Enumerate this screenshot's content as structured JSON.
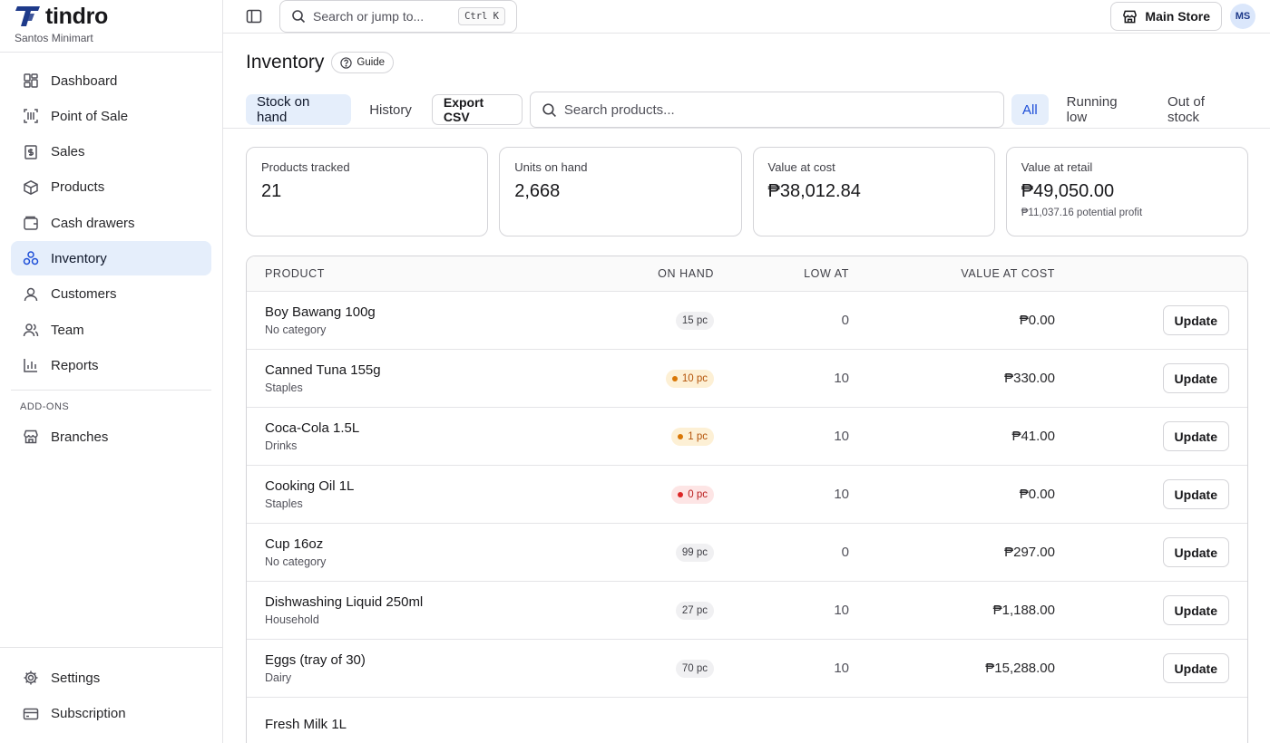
{
  "brand": {
    "name": "tindro",
    "subtitle": "Santos Minimart",
    "accent": "#1e3a8a"
  },
  "nav": {
    "items": [
      {
        "label": "Dashboard",
        "icon": "dashboard-icon"
      },
      {
        "label": "Point of Sale",
        "icon": "barcode-icon"
      },
      {
        "label": "Sales",
        "icon": "receipt-icon"
      },
      {
        "label": "Products",
        "icon": "box-icon"
      },
      {
        "label": "Cash drawers",
        "icon": "wallet-icon"
      },
      {
        "label": "Inventory",
        "icon": "boxes-icon",
        "active": true
      },
      {
        "label": "Customers",
        "icon": "user-icon"
      },
      {
        "label": "Team",
        "icon": "users-icon"
      },
      {
        "label": "Reports",
        "icon": "chart-icon"
      }
    ],
    "addons_title": "ADD-ONS",
    "addons": [
      {
        "label": "Branches",
        "icon": "store-icon"
      }
    ],
    "bottom": [
      {
        "label": "Settings",
        "icon": "gear-icon"
      },
      {
        "label": "Subscription",
        "icon": "credit-card-icon"
      }
    ]
  },
  "topbar": {
    "search_placeholder": "Search or jump to...",
    "search_shortcut": "Ctrl K",
    "store_label": "Main Store",
    "avatar_initials": "MS"
  },
  "page": {
    "title": "Inventory",
    "guide_label": "Guide",
    "tabs": [
      "Stock on hand",
      "History"
    ],
    "export_label": "Export CSV",
    "search_placeholder": "Search products...",
    "filters": [
      "All",
      "Running low",
      "Out of stock"
    ]
  },
  "stats": [
    {
      "label": "Products tracked",
      "value": "21",
      "note": ""
    },
    {
      "label": "Units on hand",
      "value": "2,668",
      "note": ""
    },
    {
      "label": "Value at cost",
      "value": "₱38,012.84",
      "note": ""
    },
    {
      "label": "Value at retail",
      "value": "₱49,050.00",
      "note": "₱11,037.16 potential profit"
    }
  ],
  "table": {
    "headers": {
      "product": "PRODUCT",
      "on_hand": "ON HAND",
      "low_at": "LOW AT",
      "value": "VALUE AT COST"
    },
    "action_label": "Update",
    "rows": [
      {
        "name": "Boy Bawang 100g",
        "category": "No category",
        "on_hand": "15 pc",
        "status": "normal",
        "low_at": "0",
        "value": "₱0.00"
      },
      {
        "name": "Canned Tuna 155g",
        "category": "Staples",
        "on_hand": "10 pc",
        "status": "low",
        "low_at": "10",
        "value": "₱330.00"
      },
      {
        "name": "Coca-Cola 1.5L",
        "category": "Drinks",
        "on_hand": "1 pc",
        "status": "low",
        "low_at": "10",
        "value": "₱41.00"
      },
      {
        "name": "Cooking Oil 1L",
        "category": "Staples",
        "on_hand": "0 pc",
        "status": "out",
        "low_at": "10",
        "value": "₱0.00"
      },
      {
        "name": "Cup 16oz",
        "category": "No category",
        "on_hand": "99 pc",
        "status": "normal",
        "low_at": "0",
        "value": "₱297.00"
      },
      {
        "name": "Dishwashing Liquid 250ml",
        "category": "Household",
        "on_hand": "27 pc",
        "status": "normal",
        "low_at": "10",
        "value": "₱1,188.00"
      },
      {
        "name": "Eggs (tray of 30)",
        "category": "Dairy",
        "on_hand": "70 pc",
        "status": "normal",
        "low_at": "10",
        "value": "₱15,288.00"
      },
      {
        "name": "Fresh Milk 1L",
        "category": "",
        "on_hand": "",
        "status": "normal",
        "low_at": "",
        "value": ""
      }
    ]
  }
}
